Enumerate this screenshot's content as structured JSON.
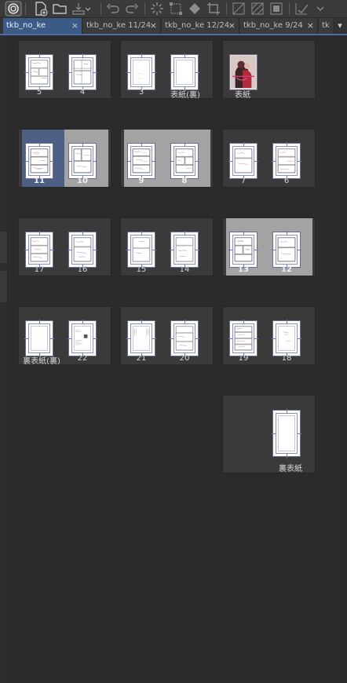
{
  "toolbar": {
    "icons": [
      "clip-studio-icon",
      "new-icon",
      "open-icon",
      "export-icon",
      "undo-icon",
      "redo-icon",
      "loading-icon",
      "transform-icon",
      "fill-icon",
      "crop-icon",
      "layer-icon",
      "select-icon",
      "frame-icon",
      "check-icon"
    ]
  },
  "tabs": [
    {
      "label": "tkb_no_ke",
      "active": true
    },
    {
      "label": "tkb_no_ke 11/24"
    },
    {
      "label": "tkb_no_ke 12/24"
    },
    {
      "label": "tkb_no_ke  9/24"
    },
    {
      "label": "tk"
    }
  ],
  "tab_close": "×",
  "tab_more": "▾",
  "spreads": [
    {
      "pages": [
        "5",
        "4"
      ]
    },
    {
      "pages": [
        "3",
        "表紙(裏)"
      ]
    },
    {
      "pages": [
        "表紙"
      ]
    },
    {
      "pages": [
        "11",
        "10"
      ]
    },
    {
      "pages": [
        "9",
        "8"
      ]
    },
    {
      "pages": [
        "7",
        "6"
      ]
    },
    {
      "pages": [
        "17",
        "16"
      ]
    },
    {
      "pages": [
        "15",
        "14"
      ]
    },
    {
      "pages": [
        "13",
        "12"
      ]
    },
    {
      "pages": [
        "裏表紙(裏)",
        "22"
      ]
    },
    {
      "pages": [
        "21",
        "20"
      ]
    },
    {
      "pages": [
        "19",
        "18"
      ]
    },
    {
      "pages": [
        "裏表紙"
      ]
    }
  ],
  "colors": {
    "accent": "#4a6fa5",
    "selected_blue": "#4d5f85",
    "selected_gray": "#a3a3a3"
  }
}
